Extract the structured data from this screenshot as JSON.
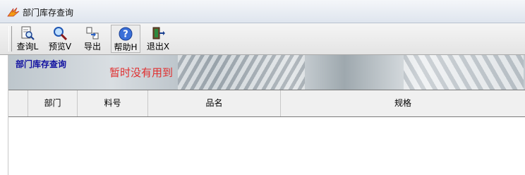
{
  "window": {
    "title": "部门库存查询",
    "icon": "app-flame-icon"
  },
  "toolbar": {
    "buttons": [
      {
        "label": "查询L",
        "icon": "query-document-magnifier-icon"
      },
      {
        "label": "预览V",
        "icon": "preview-magnifier-icon"
      },
      {
        "label": "导出",
        "icon": "export-arrow-icon"
      },
      {
        "label": "帮助H",
        "icon": "help-question-icon"
      },
      {
        "label": "退出X",
        "icon": "exit-door-icon"
      }
    ]
  },
  "banner": {
    "title": "部门库存查询",
    "note": "暂时没有用到"
  },
  "grid": {
    "columns": [
      "",
      "部门",
      "料号",
      "品名",
      "规格"
    ]
  },
  "colors": {
    "banner_title": "#1010a0",
    "note": "#e03030"
  }
}
